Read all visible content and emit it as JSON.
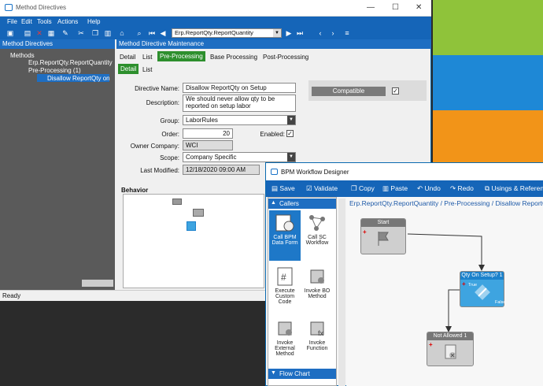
{
  "main_window": {
    "title": "Method Directives",
    "controls": {
      "minimize": "—",
      "maximize": "☐",
      "close": "✕"
    }
  },
  "menu": [
    "File",
    "Edit",
    "Tools",
    "Actions",
    "Help"
  ],
  "toolbar": {
    "combo_value": "Erp.ReportQty.ReportQuantity"
  },
  "left_panel": {
    "header": "Method Directives",
    "tree": [
      "Methods",
      "Erp.ReportQty.ReportQuantity",
      "Pre-Processing (1)",
      "Disallow ReportQty on"
    ]
  },
  "right_panel": {
    "header": "Method Directive Maintenance",
    "tabs": [
      "Detail",
      "List",
      "Pre-Processing",
      "Base Processing",
      "Post-Processing"
    ],
    "subtabs": [
      "Detail",
      "List"
    ],
    "form": {
      "directive_name_label": "Directive Name:",
      "directive_name": "Disallow ReportQty on Setup",
      "description_label": "Description:",
      "description": "We should never allow qty to be reported on setup labor",
      "group_label": "Group:",
      "group": "LaborRules",
      "order_label": "Order:",
      "order": "20",
      "enabled_label": "Enabled:",
      "owner_company_label": "Owner Company:",
      "owner_company": "WCI",
      "scope_label": "Scope:",
      "scope": "Company Specific",
      "last_modified_label": "Last Modified:",
      "last_modified": "12/18/2020 09:00 AM",
      "compatible_label": "Compatible"
    },
    "behavior_label": "Behavior"
  },
  "status": "Ready",
  "bpm": {
    "title": "BPM Workflow Designer",
    "toolbar": [
      "Save",
      "Validate",
      "Copy",
      "Paste",
      "Undo",
      "Redo",
      "Usings & Referen"
    ],
    "callers_header": "Callers",
    "palette": [
      "Call BPM Data Form",
      "Call SC Workflow",
      "Execute Custom Code",
      "Invoke BO Method",
      "Invoke External Method",
      "Invoke Function"
    ],
    "flowchart_header": "Flow Chart",
    "breadcrumb": "Erp.ReportQty.ReportQuantity / Pre-Processing / Disallow ReportQ",
    "nodes": {
      "start": "Start",
      "condition": "Qty On Setup? 1",
      "condition_false": "False",
      "condition_true": "True",
      "not_allowed": "Not Allowed 1"
    }
  },
  "colors": {
    "accent": "#1565b8",
    "active_tab": "#2d8f2d",
    "node_blue": "#3ea4e0"
  }
}
